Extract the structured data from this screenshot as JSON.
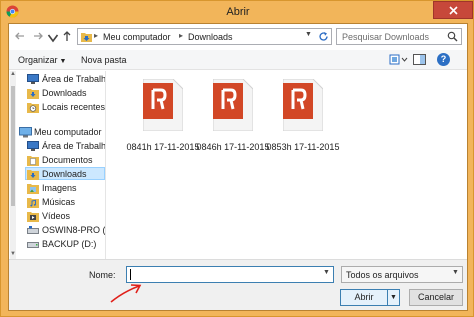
{
  "window": {
    "title": "Abrir",
    "app_icon": "chrome-icon",
    "close_icon": "close-icon"
  },
  "address_bar": {
    "crumbs": [
      "Meu computador",
      "Downloads"
    ],
    "search_placeholder": "Pesquisar Downloads"
  },
  "command_bar": {
    "organize_label": "Organizar",
    "new_folder_label": "Nova pasta",
    "help_label": "?"
  },
  "nav_pane": {
    "items": [
      {
        "label": "Área de Trabalho",
        "icon": "desktop-icon"
      },
      {
        "label": "Downloads",
        "icon": "downloads-folder-icon"
      },
      {
        "label": "Locais recentes",
        "icon": "recent-places-icon"
      },
      {
        "label": "Meu computador",
        "icon": "computer-icon"
      },
      {
        "label": "Área de Trabalho",
        "icon": "desktop-icon"
      },
      {
        "label": "Documentos",
        "icon": "documents-folder-icon"
      },
      {
        "label": "Downloads",
        "icon": "downloads-folder-icon",
        "selected": true
      },
      {
        "label": "Imagens",
        "icon": "pictures-folder-icon"
      },
      {
        "label": "Músicas",
        "icon": "music-folder-icon"
      },
      {
        "label": "Vídeos",
        "icon": "videos-folder-icon"
      },
      {
        "label": "OSWIN8-PRO (C:",
        "icon": "drive-icon"
      },
      {
        "label": "BACKUP (D:)",
        "icon": "drive-icon"
      }
    ]
  },
  "files": [
    {
      "name": "0841h 17-11-2015",
      "icon": "pdf-file-icon"
    },
    {
      "name": "0846h 17-11-2015",
      "icon": "pdf-file-icon"
    },
    {
      "name": "0853h 17-11-2015",
      "icon": "pdf-file-icon"
    }
  ],
  "bottom_bar": {
    "name_label": "Nome:",
    "name_value": "",
    "file_type": "Todos os arquivos",
    "open_label": "Abrir",
    "cancel_label": "Cancelar"
  },
  "colors": {
    "frame": "#f2b55a",
    "close": "#c7483a",
    "pdf_red": "#d24726",
    "selection": "#cce8ff",
    "annotation_arrow": "#e0201a"
  }
}
